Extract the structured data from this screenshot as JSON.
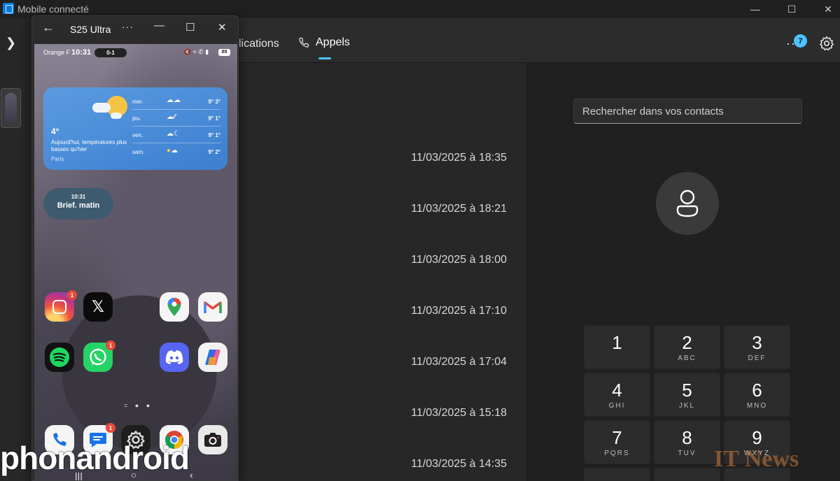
{
  "window": {
    "title": "Mobile connecté"
  },
  "header": {
    "tab_apps": "lications",
    "tab_calls": "Appels",
    "badge_count": "7",
    "accent": "#4cc2ff"
  },
  "calls": [
    "11/03/2025 à 18:35",
    "11/03/2025 à 18:21",
    "11/03/2025 à 18:00",
    "11/03/2025 à 17:10",
    "11/03/2025 à 17:04",
    "11/03/2025 à 15:18",
    "11/03/2025 à 14:35"
  ],
  "dialer": {
    "search_placeholder": "Rechercher dans vos contacts",
    "keys": [
      {
        "digit": "1",
        "letters": ""
      },
      {
        "digit": "2",
        "letters": "ABC"
      },
      {
        "digit": "3",
        "letters": "DEF"
      },
      {
        "digit": "4",
        "letters": "GHI"
      },
      {
        "digit": "5",
        "letters": "JKL"
      },
      {
        "digit": "6",
        "letters": "MNO"
      },
      {
        "digit": "7",
        "letters": "PQRS"
      },
      {
        "digit": "8",
        "letters": "TUV"
      },
      {
        "digit": "9",
        "letters": "WXYZ"
      }
    ]
  },
  "phone": {
    "window_title": "S25 Ultra",
    "carrier": "Orange F",
    "time": "10:31",
    "score": "0-1",
    "battery": "89",
    "weather": {
      "temp": "4°",
      "description": "Aujourd'hui, températures plus basses qu'hier",
      "city": "Paris",
      "days": [
        {
          "day": "mer.",
          "range": "9° 3°"
        },
        {
          "day": "jeu.",
          "range": "9° 1°"
        },
        {
          "day": "ven.",
          "range": "9° 1°"
        },
        {
          "day": "sam.",
          "range": "9° 2°"
        }
      ]
    },
    "brief": {
      "time": "10:31",
      "label": "Brief. matin"
    },
    "badges": {
      "instagram": "1",
      "whatsapp": "1",
      "messages": "1"
    }
  },
  "watermarks": {
    "left": "phonandroid",
    "right": "IT News"
  }
}
